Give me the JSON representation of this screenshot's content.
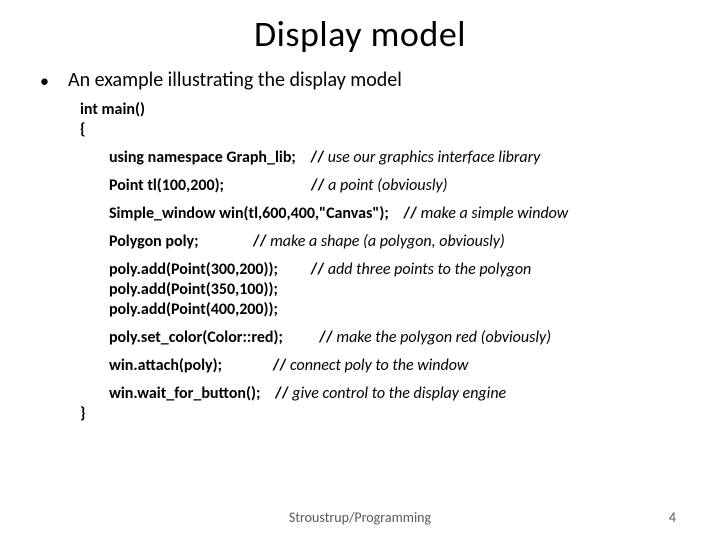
{
  "title": "Display model",
  "bullet": "An example illustrating the display model",
  "code": {
    "l0": "int main()",
    "l1": "{",
    "l2a": "        using namespace Graph_lib;    ",
    "l2b": "// ",
    "l2c": "use our graphics interface library ",
    "l3a": "        Point tl(100,200);                        ",
    "l3b": "// ",
    "l3c": "a point (obviously)",
    "l4a": "        Simple_window win(tl,600,400,\"Canvas\");    ",
    "l4b": "// ",
    "l4c": "make a simple window",
    "l5a": "        Polygon poly;               ",
    "l5b": "// ",
    "l5c": "make a shape (a polygon, obviously)",
    "l6a": "        poly.add(Point(300,200));         ",
    "l6b": "// ",
    "l6c": "add three points to the polygon",
    "l7": "        poly.add(Point(350,100));",
    "l8": "        poly.add(Point(400,200));",
    "l9a": "        poly.set_color(Color::red);          ",
    "l9b": "// ",
    "l9c": "make the polygon red (obviously)",
    "l10a": "        win.attach(poly);              ",
    "l10b": "// ",
    "l10c": "connect poly to the window",
    "l11a": "        win.wait_for_button();    ",
    "l11b": "// ",
    "l11c": "give control to the display engine",
    "l12": "}"
  },
  "footer_center": "Stroustrup/Programming",
  "footer_right": "4"
}
